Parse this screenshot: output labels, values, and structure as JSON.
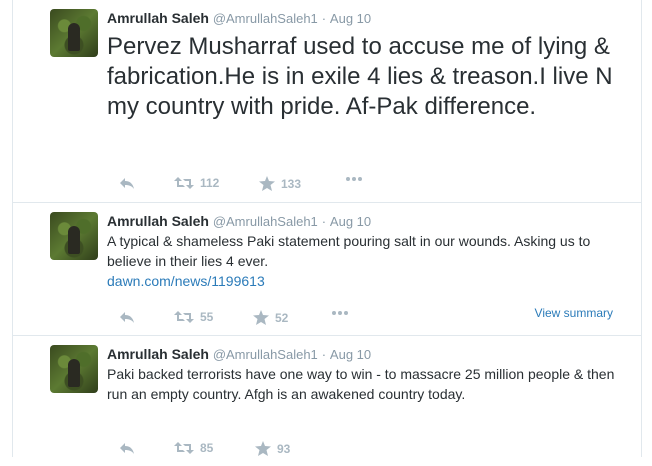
{
  "tweets": [
    {
      "name": "Amrullah Saleh",
      "handle": "@AmrullahSaleh1",
      "separator": "·",
      "date": "Aug 10",
      "text": "Pervez Musharraf used to accuse me of lying & fabrication.He is in exile 4 lies & treason.I live N my country with pride. Af-Pak difference.",
      "retweets": "112",
      "favorites": "133"
    },
    {
      "name": "Amrullah Saleh",
      "handle": "@AmrullahSaleh1",
      "separator": "·",
      "date": "Aug 10",
      "text": "A typical &  shameless Paki statement pouring salt in our wounds. Asking us to believe in their lies 4 ever.",
      "link": "dawn.com/news/1199613",
      "retweets": "55",
      "favorites": "52",
      "summary_label": "View summary"
    },
    {
      "name": "Amrullah Saleh",
      "handle": "@AmrullahSaleh1",
      "separator": "·",
      "date": "Aug 10",
      "text": "Paki backed  terrorists have one way to win - to massacre 25 million people & then run an empty country. Afgh is an awakened country today.",
      "retweets": "85",
      "favorites": "93"
    }
  ],
  "icons": [
    "reply-icon",
    "retweet-icon",
    "favorite-star-icon",
    "more-dots-icon"
  ],
  "colors": {
    "link": "#2b7bb9",
    "muted": "#8899a6",
    "action": "#aab8c2",
    "border": "#e1e8ed"
  }
}
